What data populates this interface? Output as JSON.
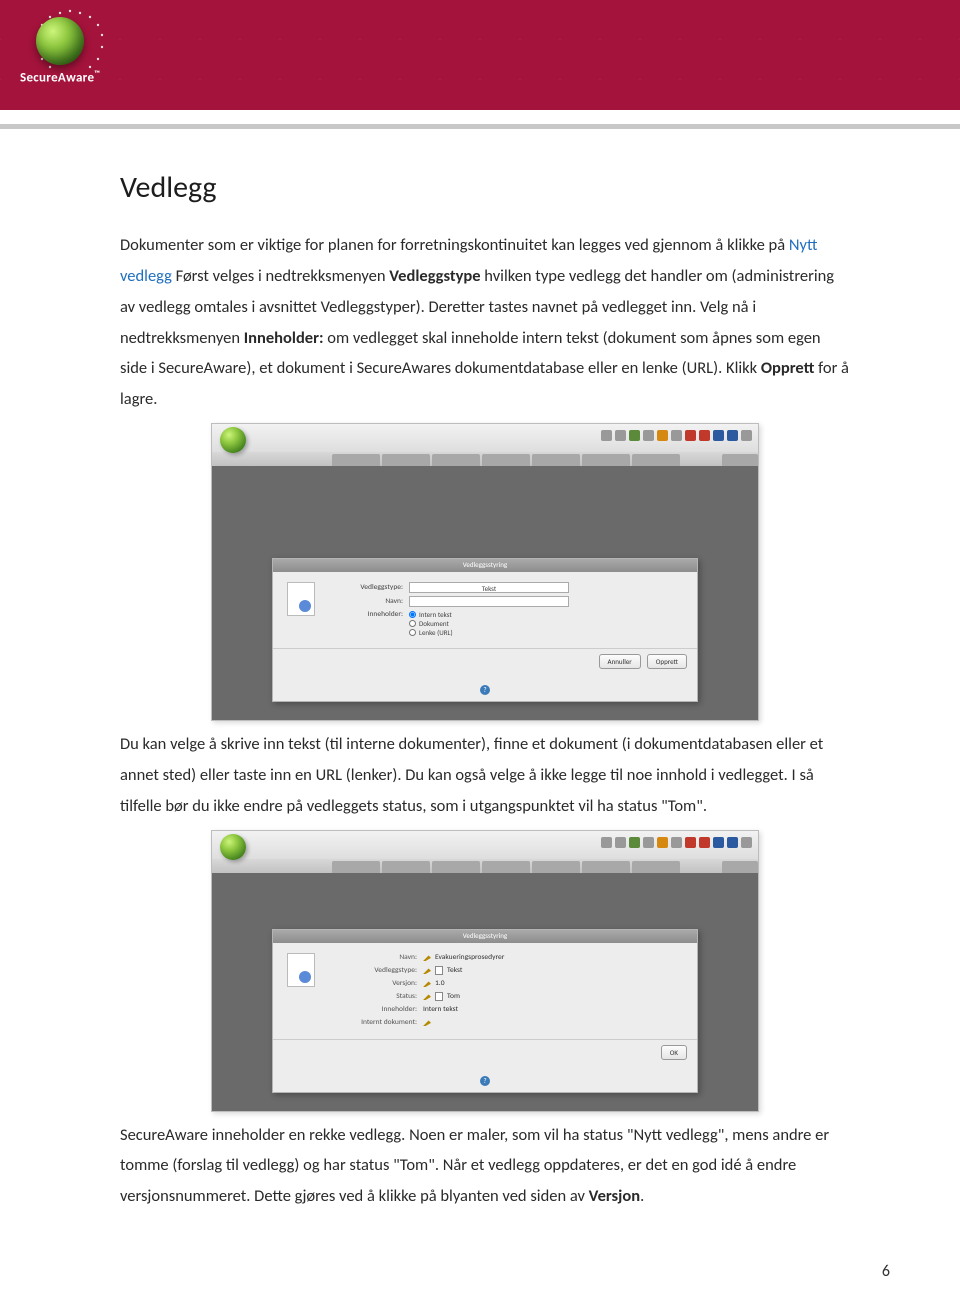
{
  "brand": {
    "name": "SecureAware",
    "tm": "™"
  },
  "title": "Vedlegg",
  "para1": {
    "t1": "Dokumenter som er viktige for planen for forretningskontinuitet kan legges ved gjennom å klikke på ",
    "link": "Nytt vedlegg",
    "t2": " Først velges i nedtrekksmenyen ",
    "b1": "Vedleggstype",
    "t3": " hvilken type vedlegg det handler om (administrering av vedlegg omtales i avsnittet Vedleggstyper). Deretter tastes navnet på vedlegget inn. Velg nå i nedtrekksmenyen ",
    "b2": "Inneholder:",
    "t4": " om vedlegget skal inneholde intern tekst (dokument som åpnes som egen side i SecureAware), et dokument i SecureAwares dokumentdatabase eller en lenke (URL). Klikk ",
    "b3": "Opprett",
    "t5": " for å lagre."
  },
  "shot1": {
    "dlgTitle": "Vedleggsstyring",
    "fields": {
      "typeLabel": "Vedleggstype:",
      "typeValue": "Tekst",
      "nameLabel": "Navn:",
      "containsLabel": "Inneholder:",
      "radio1": "Intern tekst",
      "radio2": "Dokument",
      "radio3": "Lenke (URL)"
    },
    "buttons": {
      "cancel": "Annuller",
      "create": "Opprett"
    }
  },
  "para2": "Du kan velge å skrive inn tekst (til interne dokumenter), finne et dokument (i dokumentdatabasen eller et annet sted) eller taste inn en URL (lenker). Du kan også velge å ikke legge til noe innhold i vedlegget. I så tilfelle bør du ikke endre på vedleggets status, som i utgangspunktet vil ha status \"Tom\".",
  "shot2": {
    "dlgTitle": "Vedleggsstyring",
    "rows": {
      "nameLabel": "Navn:",
      "nameVal": "Evakueringsprosedyrer",
      "typeLabel": "Vedleggstype:",
      "typeVal": "Tekst",
      "verLabel": "Versjon:",
      "verVal": "1.0",
      "statusLabel": "Status:",
      "statusVal": "Tom",
      "containsLabel": "Inneholder:",
      "containsVal": "Intern tekst",
      "attLabel": "Internt dokument:"
    },
    "ok": "OK"
  },
  "para3": {
    "t1": "SecureAware inneholder en rekke vedlegg. Noen er maler, som vil ha status \"Nytt vedlegg\", mens andre er tomme (forslag til vedlegg) og har status \"Tom\". Når et vedlegg oppdateres, er det en god idé å endre versjonsnummeret. Dette gjøres ved å klikke på blyanten ved siden av ",
    "b1": "Versjon",
    "t2": "."
  },
  "pageNumber": "6"
}
